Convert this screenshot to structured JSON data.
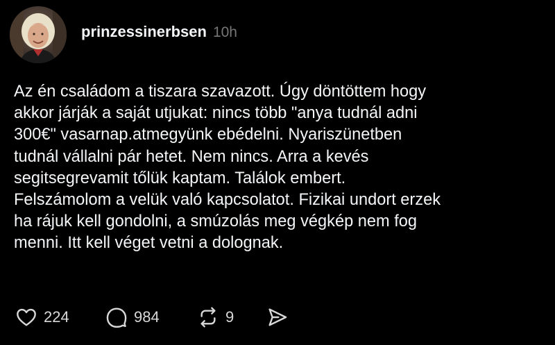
{
  "post": {
    "author": {
      "username": "prinzessinerbsen",
      "timestamp": "10h",
      "avatar_icon": "profile-photo"
    },
    "text": "Az én családom a tiszara szavazott. Úgy döntöttem hogy\nakkor járják a saját utjukat: nincs több \"anya tudnál adni\n300€\" vasarnap.atmegyünk ebédelni. Nyariszünetben\ntudnál vállalni pár hetet. Nem  nincs. Arra a kevés\nsegitsegrevamit tőlük kaptam. Találok embert.\nFelszámolom a velük való kapcsolatot. Fizikai undort erzek\nha rájuk kell gondolni, a smúzolás meg végkép nem fog\nmenni. Itt kell véget vetni a dolognak.",
    "actions": {
      "likes": {
        "icon": "heart-icon",
        "count": "224"
      },
      "replies": {
        "icon": "comment-icon",
        "count": "984"
      },
      "reposts": {
        "icon": "repost-icon",
        "count": "9"
      },
      "share": {
        "icon": "send-icon"
      }
    }
  },
  "colors": {
    "background": "#000000",
    "text": "#f3f5f7",
    "muted": "#777777",
    "icon": "#d8d8d8"
  }
}
